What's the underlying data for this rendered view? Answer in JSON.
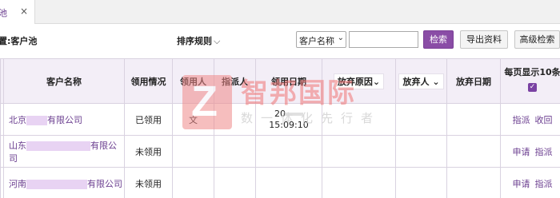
{
  "tab": {
    "label": "池",
    "close": "×"
  },
  "toolbar": {
    "breadcrumb": "置:客户池",
    "sort_label": "排序规则",
    "sort_arrow": "⌵",
    "search_field_select": "客户名称",
    "search_value": "",
    "search_button": "检索",
    "export_button": "导出资料",
    "advanced_button": "高级检索"
  },
  "table": {
    "columns": [
      "客户名称",
      "领用情况",
      "领用人",
      "指派人",
      "领用日期",
      "放弃原因",
      "放弃人",
      "放弃日期",
      "每页显示10条"
    ],
    "filter_arrow": "⌄",
    "select_all_checked": true,
    "rows": [
      {
        "name_prefix": "北京",
        "name_suffix": "有限公司",
        "status": "已领用",
        "user": "文",
        "assigner": "",
        "date_line1": "20",
        "date_line2": "15:09:10",
        "reason": "",
        "abandoner": "",
        "abandon_date": "",
        "actions": [
          "指派",
          "收回"
        ]
      },
      {
        "name_prefix": "山东",
        "name_suffix": "有限公司",
        "status": "未领用",
        "user": "",
        "assigner": "",
        "date_line1": "",
        "date_line2": "",
        "reason": "",
        "abandoner": "",
        "abandon_date": "",
        "actions": [
          "申请",
          "指派"
        ]
      },
      {
        "name_prefix": "河南",
        "name_suffix": "有限公司",
        "status": "未领用",
        "user": "",
        "assigner": "",
        "date_line1": "",
        "date_line2": "",
        "reason": "",
        "abandoner": "",
        "abandon_date": "",
        "actions": [
          "申请",
          "指派"
        ]
      }
    ]
  },
  "watermark": {
    "logo_letter": "Z",
    "title": "智邦国际",
    "subtitle": "数一体化先行者"
  }
}
